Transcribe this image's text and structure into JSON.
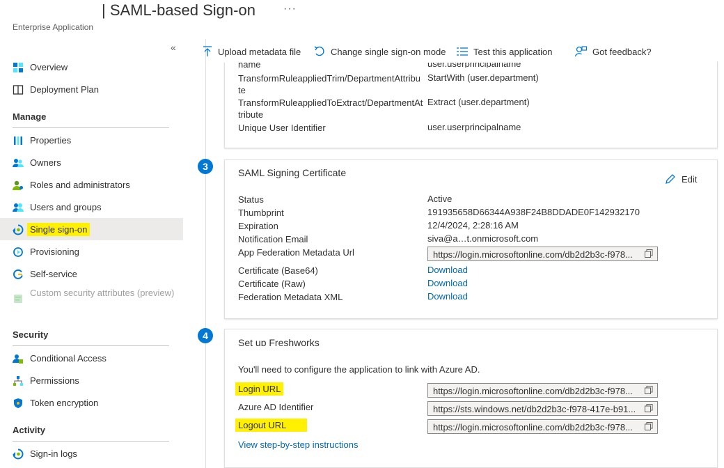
{
  "header": {
    "title": "| SAML-based Sign-on",
    "ellipsis": "···",
    "subtitle": "Enterprise Application"
  },
  "sidebar": {
    "collapse": "«",
    "top_items": [
      {
        "label": "Overview",
        "icon": "overview-icon"
      },
      {
        "label": "Deployment Plan",
        "icon": "book-icon"
      }
    ],
    "sections": [
      {
        "heading": "Manage",
        "items": [
          {
            "label": "Properties",
            "icon": "properties-icon"
          },
          {
            "label": "Owners",
            "icon": "owners-icon"
          },
          {
            "label": "Roles and administrators",
            "icon": "roles-icon"
          },
          {
            "label": "Users and groups",
            "icon": "users-icon"
          },
          {
            "label": "Single sign-on",
            "icon": "sso-icon",
            "selected": true
          },
          {
            "label": "Provisioning",
            "icon": "provisioning-icon"
          },
          {
            "label": "Self-service",
            "icon": "self-service-icon"
          },
          {
            "label": "Custom security attributes (preview)",
            "icon": "custom-attributes-icon",
            "disabled": true
          }
        ]
      },
      {
        "heading": "Security",
        "items": [
          {
            "label": "Conditional Access",
            "icon": "conditional-access-icon"
          },
          {
            "label": "Permissions",
            "icon": "permissions-icon"
          },
          {
            "label": "Token encryption",
            "icon": "shield-icon"
          }
        ]
      },
      {
        "heading": "Activity",
        "items": [
          {
            "label": "Sign-in logs",
            "icon": "signin-logs-icon"
          }
        ]
      }
    ]
  },
  "commands": {
    "upload": "Upload metadata file",
    "change_mode": "Change single sign-on mode",
    "test": "Test this application",
    "feedback": "Got feedback?"
  },
  "attributes_card": {
    "partial_top": "name",
    "partial_top_value": "user.userprincipalname",
    "rows": [
      {
        "key": "TransformRuleappliedTrim/DepartmentAttribute",
        "key_l1": "TransformRuleappliedTrim/DepartmentAttribu",
        "key_l2": "te",
        "value": "StartWith (user.department)"
      },
      {
        "key": "TransformRuleappliedToExtract/DepartmentAttribute",
        "key_l1": "TransformRuleappliedToExtract/DepartmentAt",
        "key_l2": "tribute",
        "value": "Extract (user.department)"
      },
      {
        "key_l1": "Unique User Identifier",
        "value": "user.userprincipalname"
      }
    ]
  },
  "cert_card": {
    "step": "3",
    "title": "SAML Signing Certificate",
    "edit": "Edit",
    "status_label": "Status",
    "status_value": "Active",
    "thumbprint_label": "Thumbprint",
    "thumbprint_value": "191935658D66344A938F24B8DDADE0F142932170",
    "expiration_label": "Expiration",
    "expiration_value": "12/4/2024, 2:28:16 AM",
    "email_label": "Notification Email",
    "email_value": "siva@a…t.onmicrosoft.com",
    "metadata_url_label": "App Federation Metadata Url",
    "metadata_url_value": "https://login.microsoftonline.com/db2d2b3c-f978...",
    "base64_label": "Certificate (Base64)",
    "raw_label": "Certificate (Raw)",
    "xml_label": "Federation Metadata XML",
    "download": "Download"
  },
  "setup_card": {
    "step": "4",
    "title": "Set up Freshworks",
    "intro": "You'll need to configure the application to link with Azure AD.",
    "login_url_label": "Login URL",
    "login_url_value": "https://login.microsoftonline.com/db2d2b3c-f978...",
    "identifier_label": "Azure AD Identifier",
    "identifier_value": "https://sts.windows.net/db2d2b3c-f978-417e-b91...",
    "logout_url_label": "Logout URL",
    "logout_url_value": "https://login.microsoftonline.com/db2d2b3c-f978...",
    "instructions_link": "View step-by-step instructions"
  },
  "colors": {
    "accent": "#0078d4",
    "link": "#0067b8",
    "highlight": "#fff100",
    "selected_bg": "#edebe9"
  }
}
